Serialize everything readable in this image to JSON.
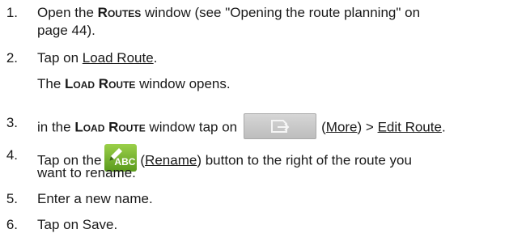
{
  "steps": [
    {
      "num": "1.",
      "parts": [
        "Open the ",
        "Routes",
        " window (see \"Opening the route planning\" on"
      ],
      "line2": "page 44)."
    },
    {
      "num": "2.",
      "parts": [
        "Tap on ",
        "Load Route",
        "."
      ],
      "line2_parts": [
        "The ",
        "Load Route",
        " window opens."
      ]
    },
    {
      "num": "3.",
      "parts": [
        "in the ",
        "Load Route",
        " window tap on",
        "(",
        "More",
        ") > ",
        "Edit Route",
        "."
      ]
    },
    {
      "num": "4.",
      "parts": [
        "Tap on the",
        "(",
        "Rename",
        ") button to the right of the route you"
      ],
      "line2": "want to rename.",
      "icon_text": "ABC"
    },
    {
      "num": "5.",
      "text": "Enter a new name."
    },
    {
      "num": "6.",
      "text": "Tap on Save."
    }
  ],
  "icons": {
    "more_button": "more-icon",
    "rename_button": "rename-icon"
  },
  "colors": {
    "more_button": "#c8c8c8",
    "rename_button": "#6fae2a"
  }
}
